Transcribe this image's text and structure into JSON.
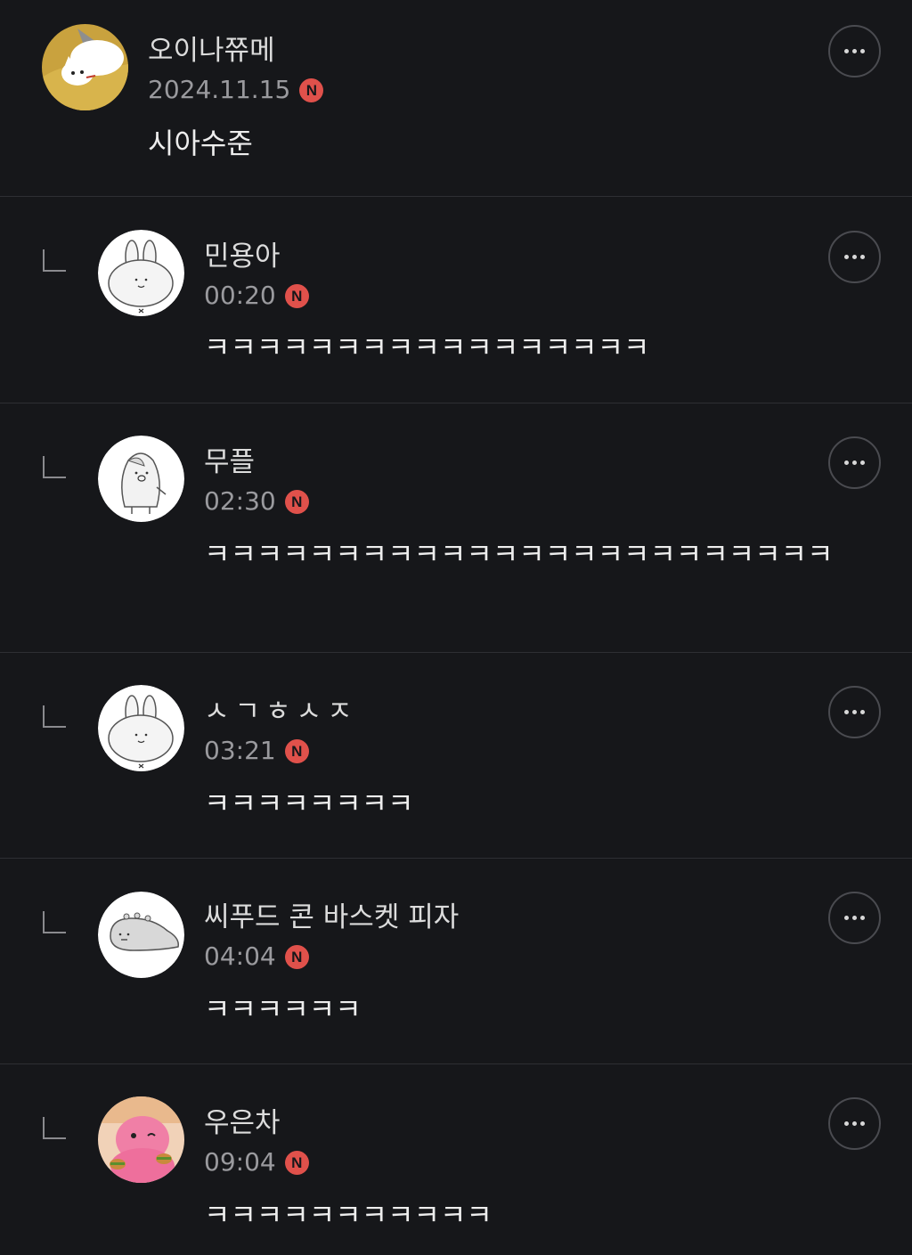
{
  "comments": [
    {
      "author": "오이나쮸메",
      "time": "2024.11.15",
      "badge": "N",
      "text": "시아수준",
      "avatar": "cat-avatar-icon",
      "is_reply": false
    },
    {
      "author": "민용아",
      "time": "00:20",
      "badge": "N",
      "text": "ㅋㅋㅋㅋㅋㅋㅋㅋㅋㅋㅋㅋㅋㅋㅋㅋㅋ",
      "avatar": "rabbit-avatar-icon",
      "is_reply": true
    },
    {
      "author": "무플",
      "time": "02:30",
      "badge": "N",
      "text": "ㅋㅋㅋㅋㅋㅋㅋㅋㅋㅋㅋㅋㅋㅋㅋㅋㅋㅋㅋㅋㅋㅋㅋㅋ",
      "avatar": "penguin-avatar-icon",
      "is_reply": true
    },
    {
      "author": "ㅅㄱㅎㅅㅈ",
      "time": "03:21",
      "badge": "N",
      "text": "ㅋㅋㅋㅋㅋㅋㅋㅋ",
      "avatar": "rabbit-avatar-icon",
      "is_reply": true
    },
    {
      "author": "씨푸드 콘 바스켓 피자",
      "time": "04:04",
      "badge": "N",
      "text": "ㅋㅋㅋㅋㅋㅋ",
      "avatar": "dinosaur-avatar-icon",
      "is_reply": true
    },
    {
      "author": "우은차",
      "time": "09:04",
      "badge": "N",
      "text": "ㅋㅋㅋㅋㅋㅋㅋㅋㅋㅋㅋ",
      "avatar": "pink-character-avatar-icon",
      "is_reply": true
    }
  ],
  "colors": {
    "background": "#16171a",
    "divider": "#2e2f33",
    "new_badge": "#e0514b"
  },
  "icons": {
    "more": "more-options-icon",
    "reply": "reply-arrow-icon"
  }
}
